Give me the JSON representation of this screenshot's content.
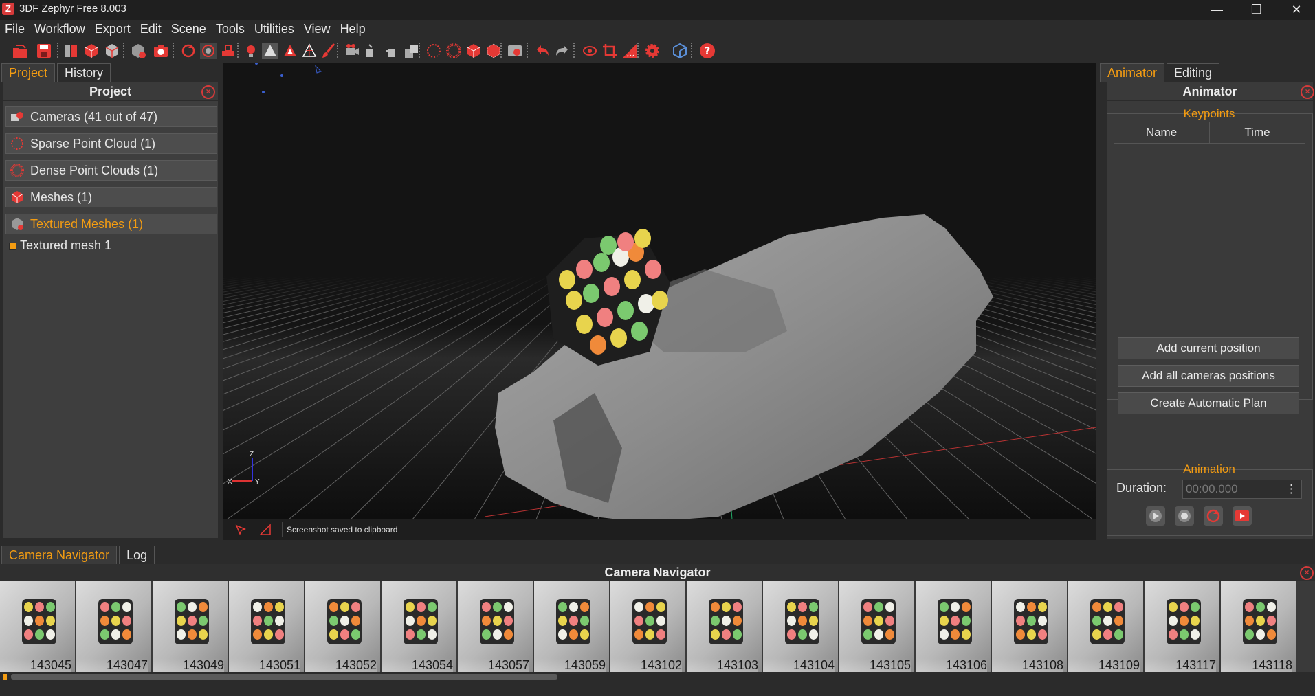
{
  "window": {
    "title": "3DF Zephyr Free 8.003",
    "app_icon_letter": "Z",
    "controls": {
      "minimize": "—",
      "maximize": "❐",
      "close": "✕"
    }
  },
  "menu": [
    "File",
    "Workflow",
    "Export",
    "Edit",
    "Scene",
    "Tools",
    "Utilities",
    "View",
    "Help"
  ],
  "left_panel": {
    "tabs": [
      "Project",
      "History"
    ],
    "title": "Project",
    "categories": [
      {
        "label": "Cameras (41 out of 47)",
        "icon": "cameras-icon"
      },
      {
        "label": "Sparse Point Cloud (1)",
        "icon": "sparse-cloud-icon"
      },
      {
        "label": "Dense Point Clouds (1)",
        "icon": "dense-cloud-icon"
      },
      {
        "label": "Meshes (1)",
        "icon": "mesh-icon"
      },
      {
        "label": "Textured Meshes (1)",
        "icon": "textured-mesh-icon"
      }
    ],
    "textured_mesh_item": "Textured mesh 1"
  },
  "viewport": {
    "status": "Screenshot saved to clipboard",
    "axis_labels": {
      "x": "X",
      "y": "Y",
      "z": "Z"
    }
  },
  "right_panel": {
    "tabs": [
      "Animator",
      "Editing"
    ],
    "title": "Animator",
    "keypoints": {
      "title": "Keypoints",
      "col_name": "Name",
      "col_time": "Time"
    },
    "buttons": [
      "Add current position",
      "Add all cameras positions",
      "Create Automatic Plan"
    ],
    "animation": {
      "title": "Animation",
      "duration_label": "Duration:",
      "duration_value": "00:00.000",
      "spinner": "⋮"
    }
  },
  "bottom": {
    "tabs": [
      "Camera Navigator",
      "Log"
    ],
    "title": "Camera Navigator",
    "thumbnails": [
      "143045",
      "143047",
      "143049",
      "143051",
      "143052",
      "143054",
      "143057",
      "143059",
      "143102",
      "143103",
      "143104",
      "143105",
      "143106",
      "143108",
      "143109",
      "143117",
      "143118"
    ]
  },
  "colors": {
    "accent": "#f39c12",
    "close_red": "#d63a3a",
    "toolbar_red": "#e53935"
  }
}
